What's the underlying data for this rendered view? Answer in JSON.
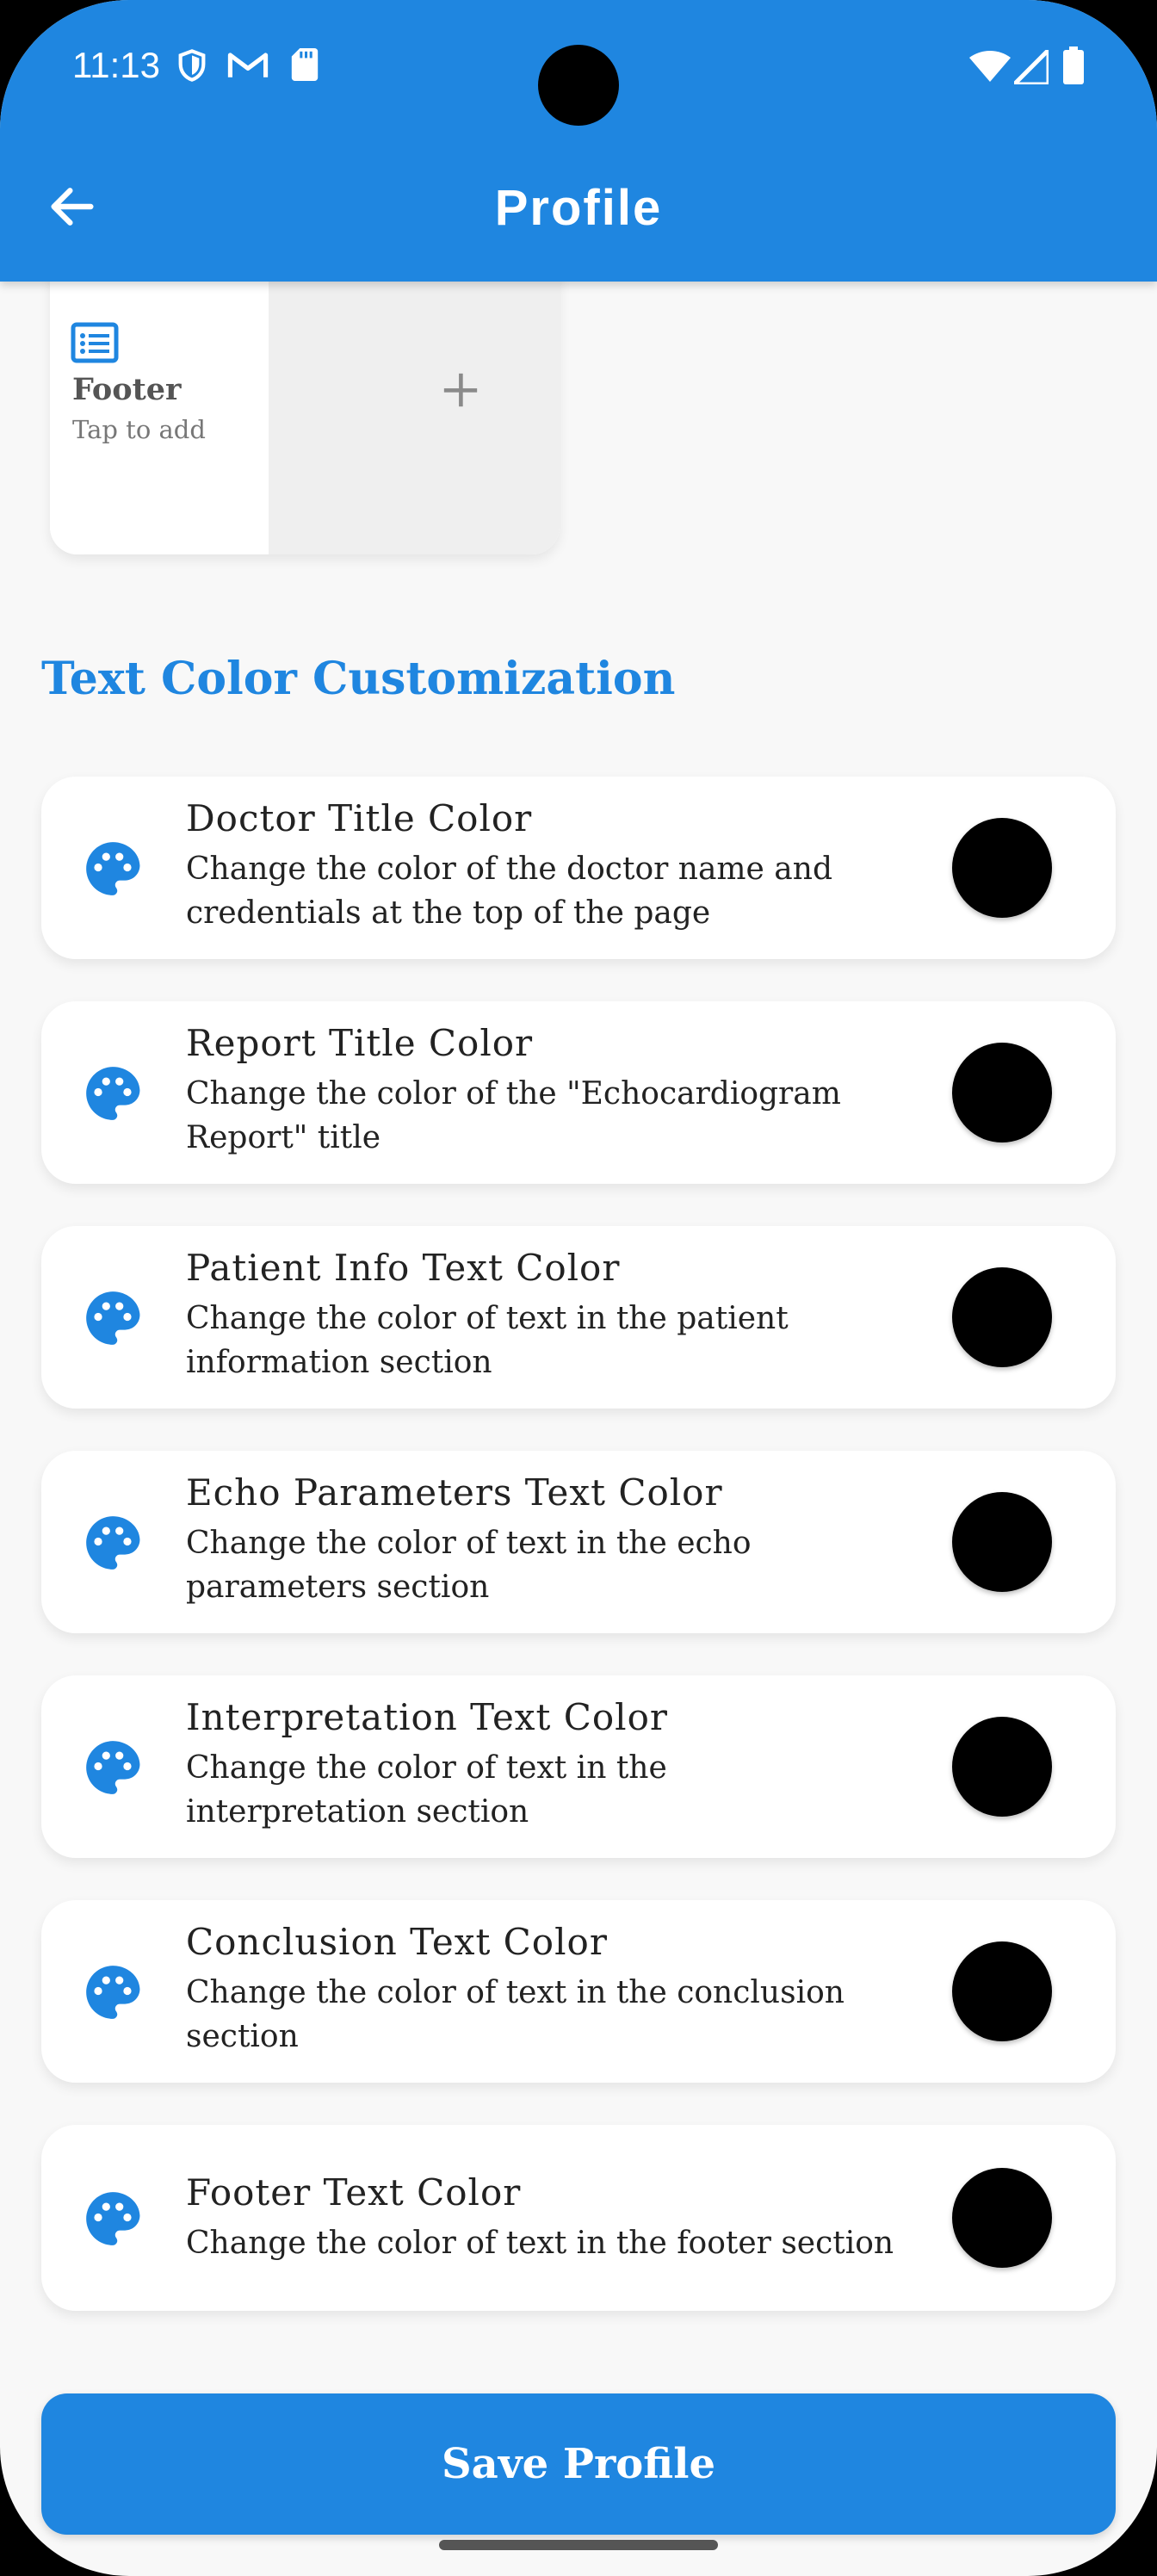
{
  "status_bar": {
    "time": "11:13",
    "icons": [
      "shield-icon",
      "gmail-icon",
      "sd-card-icon",
      "wifi-icon",
      "signal-icon",
      "battery-icon"
    ]
  },
  "header": {
    "title": "Profile",
    "back_icon": "arrow-back-icon"
  },
  "image_section": {
    "footer_card": {
      "label": "Footer",
      "hint": "Tap to add",
      "icon": "list-icon"
    },
    "add_icon": "plus-icon"
  },
  "text_color_section": {
    "heading": "Text Color Customization",
    "items": [
      {
        "title": "Doctor Title Color",
        "description": "Change the color of the doctor name and credentials at the top of the page",
        "color": "#000000"
      },
      {
        "title": "Report Title Color",
        "description": "Change the color of the \"Echocardiogram Report\" title",
        "color": "#000000"
      },
      {
        "title": "Patient Info Text Color",
        "description": "Change the color of text in the patient information section",
        "color": "#000000"
      },
      {
        "title": "Echo Parameters Text Color",
        "description": "Change the color of text in the echo parameters section",
        "color": "#000000"
      },
      {
        "title": "Interpretation Text Color",
        "description": "Change the color of text in the interpretation section",
        "color": "#000000"
      },
      {
        "title": "Conclusion Text Color",
        "description": "Change the color of text in the conclusion section",
        "color": "#000000"
      },
      {
        "title": "Footer Text Color",
        "description": "Change the color of text in the footer section",
        "color": "#000000"
      }
    ]
  },
  "save_button": {
    "label": "Save Profile"
  },
  "colors": {
    "primary": "#1f86e0",
    "background": "#f8f8f8"
  }
}
